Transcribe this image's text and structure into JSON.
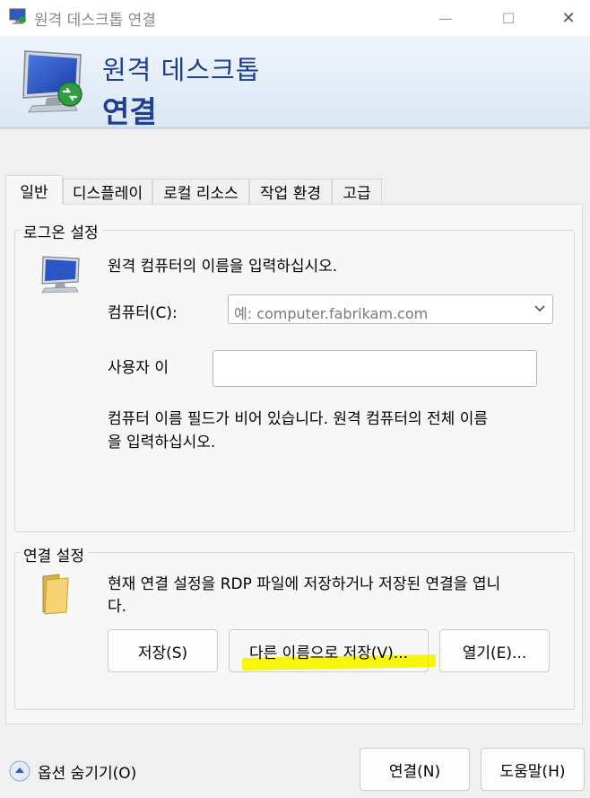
{
  "window": {
    "title": "원격 데스크톱 연결",
    "min_glyph": "—",
    "max_glyph": "☐",
    "close_glyph": "✕"
  },
  "header": {
    "line1": "원격 데스크톱",
    "line2": "연결"
  },
  "tabs": [
    {
      "label": "일반",
      "active": true
    },
    {
      "label": "디스플레이"
    },
    {
      "label": "로컬 리소스"
    },
    {
      "label": "작업 환경"
    },
    {
      "label": "고급"
    }
  ],
  "logon": {
    "title": "로그온 설정",
    "instruction": "원격 컴퓨터의 이름을 입력하십시오.",
    "computer_label": "컴퓨터(C):",
    "computer_placeholder": "예: computer.fabrikam.com",
    "username_label": "사용자 이",
    "username_value": "",
    "warning_line1": "컴퓨터 이름 필드가 비어 있습니다. 원격 컴퓨터의 전체 이름",
    "warning_line2": "을 입력하십시오."
  },
  "connection": {
    "title": "연결 설정",
    "desc_line1": "현재 연결 설정을 RDP 파일에 저장하거나 저장된 연결을 엽니",
    "desc_line2": "다.",
    "save_label": "저장(S)",
    "save_as_label": "다른 이름으로 저장(V)...",
    "open_label": "열기(E)..."
  },
  "footer": {
    "options_label": "옵션 숨기기(O)",
    "connect_label": "연결(N)",
    "help_label": "도움말(H)"
  },
  "colors": {
    "brand_blue": "#1d3f8f",
    "highlight": "#f7f300"
  }
}
